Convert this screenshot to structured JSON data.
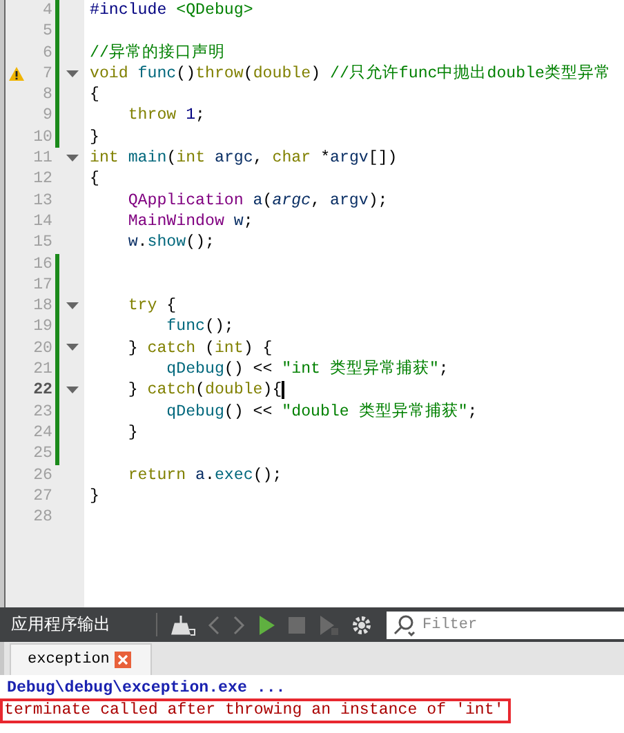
{
  "editor": {
    "lines": [
      {
        "number": "4",
        "changed": true,
        "fold": false,
        "warning": false,
        "current": false,
        "tokens": [
          {
            "kind": "pre",
            "text": "#include "
          },
          {
            "kind": "str",
            "text": "<QDebug>"
          }
        ]
      },
      {
        "number": "5",
        "changed": true,
        "fold": false,
        "warning": false,
        "current": false
      },
      {
        "number": "6",
        "changed": true,
        "fold": false,
        "warning": false,
        "current": false,
        "tokens": [
          {
            "kind": "comment",
            "text": "//异常的接口声明"
          }
        ]
      },
      {
        "number": "7",
        "changed": true,
        "fold": true,
        "warning": true,
        "current": false,
        "tokens": [
          {
            "kind": "kw",
            "text": "void "
          },
          {
            "kind": "fn",
            "text": "func"
          },
          {
            "kind": "plain",
            "text": "()"
          },
          {
            "kind": "kw",
            "text": "throw"
          },
          {
            "kind": "plain",
            "text": "("
          },
          {
            "kind": "kw",
            "text": "double"
          },
          {
            "kind": "plain",
            "text": ") "
          },
          {
            "kind": "comment",
            "text": "//只允许func中抛出double类型异常"
          }
        ]
      },
      {
        "number": "8",
        "changed": true,
        "fold": false,
        "warning": false,
        "current": false,
        "tokens": [
          {
            "kind": "plain",
            "text": "{"
          }
        ]
      },
      {
        "number": "9",
        "changed": true,
        "fold": false,
        "warning": false,
        "current": false,
        "tokens": [
          {
            "kind": "kw",
            "text": "    throw "
          },
          {
            "kind": "num",
            "text": "1"
          },
          {
            "kind": "plain",
            "text": ";"
          }
        ]
      },
      {
        "number": "10",
        "changed": true,
        "fold": false,
        "warning": false,
        "current": false,
        "tokens": [
          {
            "kind": "plain",
            "text": "}"
          }
        ]
      },
      {
        "number": "11",
        "changed": false,
        "fold": true,
        "warning": false,
        "current": false,
        "tokens": [
          {
            "kind": "kw",
            "text": "int "
          },
          {
            "kind": "fn",
            "text": "main"
          },
          {
            "kind": "plain",
            "text": "("
          },
          {
            "kind": "kw",
            "text": "int "
          },
          {
            "kind": "local",
            "text": "argc"
          },
          {
            "kind": "plain",
            "text": ", "
          },
          {
            "kind": "kw",
            "text": "char "
          },
          {
            "kind": "plain",
            "text": "*"
          },
          {
            "kind": "local",
            "text": "argv"
          },
          {
            "kind": "plain",
            "text": "[])"
          }
        ]
      },
      {
        "number": "12",
        "changed": false,
        "fold": false,
        "warning": false,
        "current": false,
        "tokens": [
          {
            "kind": "plain",
            "text": "{"
          }
        ]
      },
      {
        "number": "13",
        "changed": false,
        "fold": false,
        "warning": false,
        "current": false,
        "tokens": [
          {
            "kind": "type",
            "text": "    QApplication "
          },
          {
            "kind": "local",
            "text": "a"
          },
          {
            "kind": "plain",
            "text": "("
          },
          {
            "kind": "param",
            "text": "argc"
          },
          {
            "kind": "plain",
            "text": ", "
          },
          {
            "kind": "local",
            "text": "argv"
          },
          {
            "kind": "plain",
            "text": ");"
          }
        ]
      },
      {
        "number": "14",
        "changed": false,
        "fold": false,
        "warning": false,
        "current": false,
        "tokens": [
          {
            "kind": "type",
            "text": "    MainWindow "
          },
          {
            "kind": "local",
            "text": "w"
          },
          {
            "kind": "plain",
            "text": ";"
          }
        ]
      },
      {
        "number": "15",
        "changed": false,
        "fold": false,
        "warning": false,
        "current": false,
        "tokens": [
          {
            "kind": "local",
            "text": "    w"
          },
          {
            "kind": "plain",
            "text": "."
          },
          {
            "kind": "fn",
            "text": "show"
          },
          {
            "kind": "plain",
            "text": "();"
          }
        ]
      },
      {
        "number": "16",
        "changed": true,
        "fold": false,
        "warning": false,
        "current": false
      },
      {
        "number": "17",
        "changed": true,
        "fold": false,
        "warning": false,
        "current": false
      },
      {
        "number": "18",
        "changed": true,
        "fold": true,
        "warning": false,
        "current": false,
        "tokens": [
          {
            "kind": "kw",
            "text": "    try "
          },
          {
            "kind": "plain",
            "text": "{"
          }
        ]
      },
      {
        "number": "19",
        "changed": true,
        "fold": false,
        "warning": false,
        "current": false,
        "tokens": [
          {
            "kind": "fn",
            "text": "        func"
          },
          {
            "kind": "plain",
            "text": "();"
          }
        ]
      },
      {
        "number": "20",
        "changed": true,
        "fold": true,
        "warning": false,
        "current": false,
        "tokens": [
          {
            "kind": "plain",
            "text": "    } "
          },
          {
            "kind": "kw",
            "text": "catch "
          },
          {
            "kind": "plain",
            "text": "("
          },
          {
            "kind": "kw",
            "text": "int"
          },
          {
            "kind": "plain",
            "text": ") {"
          }
        ]
      },
      {
        "number": "21",
        "changed": true,
        "fold": false,
        "warning": false,
        "current": false,
        "tokens": [
          {
            "kind": "fn",
            "text": "        qDebug"
          },
          {
            "kind": "plain",
            "text": "() << "
          },
          {
            "kind": "str",
            "text": "\"int 类型异常捕获\""
          },
          {
            "kind": "plain",
            "text": ";"
          }
        ]
      },
      {
        "number": "22",
        "changed": true,
        "fold": true,
        "warning": false,
        "current": true,
        "tokens": [
          {
            "kind": "plain",
            "text": "    } "
          },
          {
            "kind": "kw",
            "text": "catch"
          },
          {
            "kind": "plain",
            "text": "("
          },
          {
            "kind": "kw",
            "text": "double"
          },
          {
            "kind": "plain",
            "text": "){"
          }
        ]
      },
      {
        "number": "23",
        "changed": true,
        "fold": false,
        "warning": false,
        "current": false,
        "tokens": [
          {
            "kind": "fn",
            "text": "        qDebug"
          },
          {
            "kind": "plain",
            "text": "() << "
          },
          {
            "kind": "str",
            "text": "\"double 类型异常捕获\""
          },
          {
            "kind": "plain",
            "text": ";"
          }
        ]
      },
      {
        "number": "24",
        "changed": true,
        "fold": false,
        "warning": false,
        "current": false,
        "tokens": [
          {
            "kind": "plain",
            "text": "    }"
          }
        ]
      },
      {
        "number": "25",
        "changed": true,
        "fold": false,
        "warning": false,
        "current": false
      },
      {
        "number": "26",
        "changed": false,
        "fold": false,
        "warning": false,
        "current": false,
        "tokens": [
          {
            "kind": "kw",
            "text": "    return "
          },
          {
            "kind": "local",
            "text": "a"
          },
          {
            "kind": "plain",
            "text": "."
          },
          {
            "kind": "fn",
            "text": "exec"
          },
          {
            "kind": "plain",
            "text": "();"
          }
        ]
      },
      {
        "number": "27",
        "changed": false,
        "fold": false,
        "warning": false,
        "current": false,
        "tokens": [
          {
            "kind": "plain",
            "text": "}"
          }
        ]
      },
      {
        "number": "28",
        "changed": false,
        "fold": false,
        "warning": false,
        "current": false
      }
    ]
  },
  "output_pane": {
    "title": "应用程序输出",
    "filter": {
      "placeholder": "Filter"
    },
    "tabs": [
      {
        "label": "exception",
        "selected": true
      }
    ],
    "lines": [
      {
        "kind": "info",
        "text": "Debug\\debug\\exception.exe ...",
        "highlighted": false
      },
      {
        "kind": "error",
        "text": "terminate called after throwing an instance of 'int'",
        "highlighted": true
      }
    ]
  }
}
